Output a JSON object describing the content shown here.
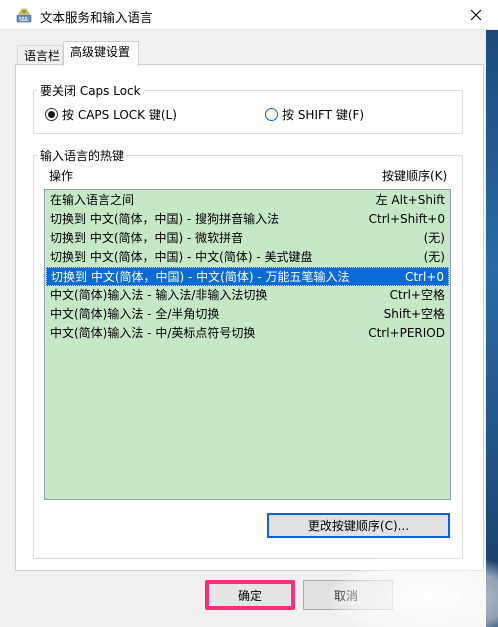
{
  "window": {
    "title": "文本服务和输入语言",
    "close_glyph": "✕"
  },
  "tabs": [
    {
      "label": "语言栏"
    },
    {
      "label": "高级键设置"
    }
  ],
  "caps_lock": {
    "title": "要关闭 Caps Lock",
    "options": [
      {
        "label": "按 CAPS LOCK 键(L)",
        "checked": true
      },
      {
        "label": "按 SHIFT 键(F)",
        "checked": false
      }
    ]
  },
  "hotkeys": {
    "title": "输入语言的热键",
    "col_action": "操作",
    "col_sequence": "按键顺序(K)",
    "rows": [
      {
        "action": "在输入语言之间",
        "key": "左 Alt+Shift",
        "selected": false
      },
      {
        "action": "切换到 中文(简体，中国) - 搜狗拼音输入法",
        "key": "Ctrl+Shift+0",
        "selected": false
      },
      {
        "action": "切换到 中文(简体，中国) - 微软拼音",
        "key": "(无)",
        "selected": false
      },
      {
        "action": "切换到 中文(简体，中国) - 中文(简体) - 美式键盘",
        "key": "(无)",
        "selected": false
      },
      {
        "action": "切换到 中文(简体，中国) - 中文(简体) - 万能五笔输入法",
        "key": "Ctrl+0",
        "selected": true
      },
      {
        "action": "中文(简体)输入法 - 输入法/非输入法切换",
        "key": "Ctrl+空格",
        "selected": false
      },
      {
        "action": "中文(简体)输入法 - 全/半角切换",
        "key": "Shift+空格",
        "selected": false
      },
      {
        "action": "中文(简体)输入法 - 中/英标点符号切换",
        "key": "Ctrl+PERIOD",
        "selected": false
      }
    ],
    "change_button": "更改按键顺序(C)..."
  },
  "buttons": {
    "ok": "确定",
    "cancel": "取消"
  },
  "colors": {
    "list_bg": "#c7e8c7",
    "selection": "#0a6bd8",
    "highlight_frame": "#ff2d78"
  }
}
